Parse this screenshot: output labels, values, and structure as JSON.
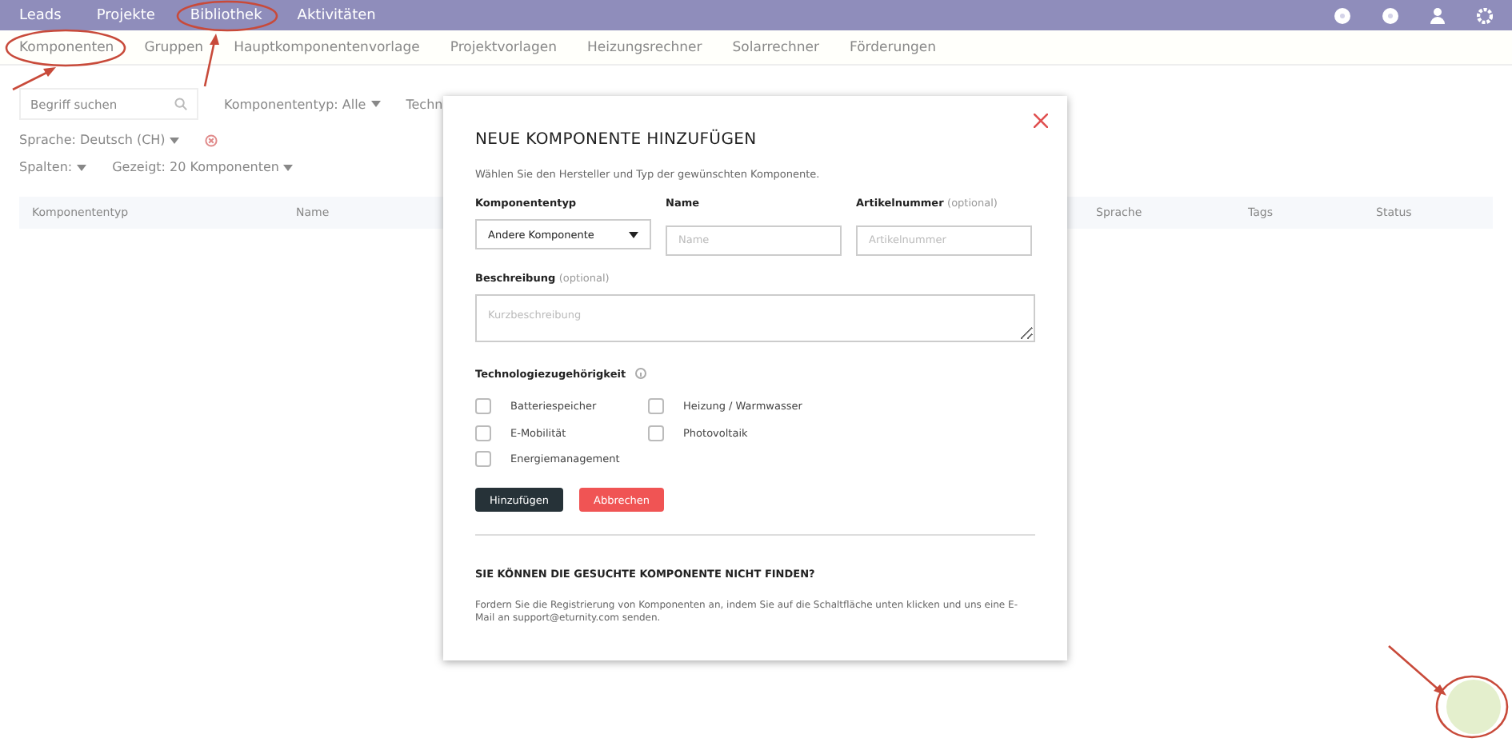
{
  "nav": {
    "items": [
      "Leads",
      "Projekte",
      "Bibliothek",
      "Aktivitäten"
    ]
  },
  "tabs": [
    "Komponenten",
    "Gruppen",
    "Hauptkomponentenvorlage",
    "Projektvorlagen",
    "Heizungsrechner",
    "Solarrechner",
    "Förderungen"
  ],
  "filters": {
    "search_placeholder": "Begriff suchen",
    "type_label": "Komponententyp:",
    "type_value": "Alle",
    "tech_label": "Techn",
    "language_label": "Sprache:",
    "language_value": "Deutsch (CH)",
    "columns_label": "Spalten:",
    "shown_label": "Gezeigt:",
    "shown_value": "20 Komponenten"
  },
  "table": {
    "columns": [
      "Komponententyp",
      "Name",
      "Sprache",
      "Tags",
      "Status"
    ]
  },
  "modal": {
    "title": "NEUE KOMPONENTE HINZUFÜGEN",
    "subtitle": "Wählen Sie den Hersteller und Typ der gewünschten Komponente.",
    "type_label": "Komponententyp",
    "type_value": "Andere Komponente",
    "name_label": "Name",
    "name_placeholder": "Name",
    "article_label": "Artikelnummer",
    "article_hint": "(optional)",
    "article_placeholder": "Artikelnummer",
    "description_label": "Beschreibung",
    "description_hint": "(optional)",
    "description_placeholder": "Kurzbeschreibung",
    "technology_label": "Technologiezugehörigkeit",
    "technologies": [
      {
        "label": "Batteriespeicher",
        "checked": false
      },
      {
        "label": "E-Mobilität",
        "checked": false
      },
      {
        "label": "Energiemanagement",
        "checked": false
      },
      {
        "label": "Heizung / Warmwasser",
        "checked": false
      },
      {
        "label": "Photovoltaik",
        "checked": false
      }
    ],
    "buttons": [
      {
        "label": "Hinzufügen",
        "kind": "primary"
      },
      {
        "label": "Abbrechen",
        "kind": "danger"
      }
    ],
    "missing_title": "SIE KÖNNEN DIE GESUCHTE KOMPONENTE NICHT FINDEN?",
    "missing_text": "Fordern Sie die Registrierung von Komponenten an, indem Sie auf die Schaltfläche unten klicken und uns eine E-Mail an support@eturnity.com senden."
  }
}
